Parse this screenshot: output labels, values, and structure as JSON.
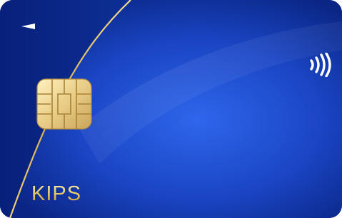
{
  "card": {
    "brand": "KIPS",
    "features": [
      "chip-icon",
      "contactless-icon",
      "insert-direction-arrow-icon"
    ],
    "colors": {
      "base": "#0b2a8c",
      "highlight": "#2f5fe0",
      "gold": "#d6b25a",
      "white": "#ffffff"
    }
  }
}
